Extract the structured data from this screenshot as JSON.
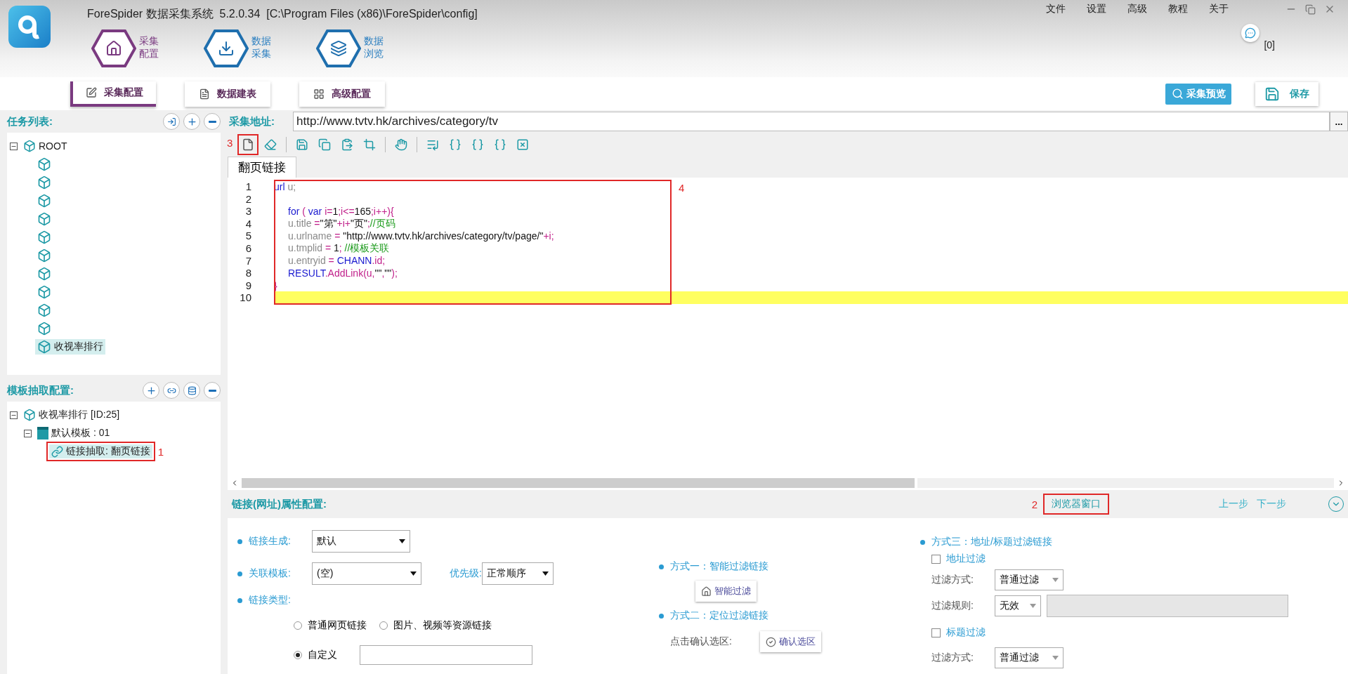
{
  "window": {
    "title": "ForeSpider 数据采集系统  5.2.0.34  [C:\\Program Files (x86)\\ForeSpider\\config]"
  },
  "menu": [
    "文件",
    "设置",
    "高级",
    "教程",
    "关于"
  ],
  "nav": [
    {
      "label": "采集配置",
      "selected": true
    },
    {
      "label": "数据采集",
      "selected": false
    },
    {
      "label": "数据浏览",
      "selected": false
    }
  ],
  "messages": {
    "count": "[0]"
  },
  "subtabs": [
    {
      "label": "采集配置",
      "selected": true
    },
    {
      "label": "数据建表",
      "selected": false
    },
    {
      "label": "高级配置",
      "selected": false
    }
  ],
  "actions": {
    "preview": "采集预览",
    "save": "保存"
  },
  "task_list": {
    "title": "任务列表:",
    "root": {
      "label": "ROOT",
      "expanded": true,
      "children": [
        {
          "selected": false
        },
        {
          "selected": false
        },
        {
          "selected": false
        },
        {
          "selected": false
        },
        {
          "selected": false
        },
        {
          "selected": false
        },
        {
          "selected": false
        },
        {
          "selected": false
        },
        {
          "selected": false
        },
        {
          "selected": false
        },
        {
          "label": "收视率排行",
          "selected": true
        }
      ]
    }
  },
  "template": {
    "title": "模板抽取配置:",
    "tree": [
      {
        "label": "收视率排行 [ID:25]",
        "kind": "task",
        "expanded": true,
        "selected": false,
        "children": [
          {
            "label": "默认模板 : 01",
            "kind": "template",
            "expanded": true,
            "selected": false,
            "children": [
              {
                "label": "链接抽取: 翻页链接",
                "kind": "link",
                "selected": true,
                "annotation": "1"
              }
            ]
          }
        ]
      }
    ]
  },
  "address": {
    "label": "采集地址:",
    "value": "http://www.tvtv.hk/archives/category/tv",
    "button": "..."
  },
  "toolbar": {
    "annotation": "3"
  },
  "editor_tabs": [
    {
      "label": "翻页链接",
      "selected": true
    }
  ],
  "editor": {
    "annotation": "4",
    "lines": [
      {
        "number": "1",
        "indented": false,
        "current": false,
        "tokens": [
          {
            "kind": "keyword",
            "text": "url"
          },
          {
            "kind": "member",
            "text": " u;"
          }
        ]
      },
      {
        "number": "2",
        "current": false
      },
      {
        "number": "3",
        "indented": true,
        "current": false,
        "tokens": [
          {
            "kind": "keyword",
            "text": "for"
          },
          {
            "kind": "punct",
            "text": " ( "
          },
          {
            "kind": "keyword",
            "text": "var"
          },
          {
            "kind": "punct",
            "text": " i="
          },
          {
            "kind": "plain",
            "text": "1"
          },
          {
            "kind": "punct",
            "text": ";i<="
          },
          {
            "kind": "plain",
            "text": "165"
          },
          {
            "kind": "punct",
            "text": ";i++){"
          }
        ]
      },
      {
        "number": "4",
        "indented": true,
        "current": false,
        "tokens": [
          {
            "kind": "member",
            "text": "u.title"
          },
          {
            "kind": "punct",
            "text": " ="
          },
          {
            "kind": "string",
            "text": "\"第\""
          },
          {
            "kind": "punct",
            "text": "+i+"
          },
          {
            "kind": "string",
            "text": "\"页\""
          },
          {
            "kind": "punct",
            "text": ";"
          },
          {
            "kind": "comment",
            "text": "//页码"
          }
        ]
      },
      {
        "number": "5",
        "indented": true,
        "current": false,
        "tokens": [
          {
            "kind": "member",
            "text": "u.urlname"
          },
          {
            "kind": "punct",
            "text": " = "
          },
          {
            "kind": "string",
            "text": "\"http://www.tvtv.hk/archives/category/tv/page/\""
          },
          {
            "kind": "punct",
            "text": "+i;"
          }
        ]
      },
      {
        "number": "6",
        "indented": true,
        "current": false,
        "tokens": [
          {
            "kind": "member",
            "text": "u.tmplid"
          },
          {
            "kind": "punct",
            "text": " = "
          },
          {
            "kind": "plain",
            "text": "1"
          },
          {
            "kind": "punct",
            "text": "; "
          },
          {
            "kind": "comment",
            "text": "//模板关联"
          }
        ]
      },
      {
        "number": "7",
        "indented": true,
        "current": false,
        "tokens": [
          {
            "kind": "member",
            "text": "u.entryid"
          },
          {
            "kind": "punct",
            "text": " = "
          },
          {
            "kind": "keyword",
            "text": "CHANN"
          },
          {
            "kind": "punct",
            "text": ".id;"
          }
        ]
      },
      {
        "number": "8",
        "indented": true,
        "current": false,
        "tokens": [
          {
            "kind": "keyword",
            "text": "RESULT"
          },
          {
            "kind": "punct",
            "text": ".AddLink(u,"
          },
          {
            "kind": "string",
            "text": "\"\""
          },
          {
            "kind": "punct",
            "text": ","
          },
          {
            "kind": "string",
            "text": "\"\""
          },
          {
            "kind": "punct",
            "text": ");"
          }
        ]
      },
      {
        "number": "9",
        "indented": false,
        "current": false,
        "tokens": [
          {
            "kind": "punct",
            "text": "}"
          }
        ]
      },
      {
        "number": "10",
        "current": true
      }
    ]
  },
  "properties": {
    "title": "链接(网址)属性配置:",
    "browser_button": {
      "label": "浏览器窗口",
      "annotation": "2"
    },
    "prev": "上一步",
    "next": "下一步",
    "link_gen": {
      "label": "链接生成:",
      "value": "默认"
    },
    "template": {
      "label": "关联模板:",
      "value": "(空)"
    },
    "priority": {
      "label": "优先级:",
      "value": "正常顺序"
    },
    "link_type": {
      "label": "链接类型:",
      "options": [
        {
          "label": "普通网页链接",
          "selected": false
        },
        {
          "label": "图片、视频等资源链接",
          "selected": false
        },
        {
          "label": "自定义",
          "selected": true
        }
      ]
    },
    "method1": {
      "label": "方式一：智能过滤链接",
      "button": "智能过滤"
    },
    "method2": {
      "label": "方式二：定位过滤链接",
      "prompt": "点击确认选区:",
      "button": "确认选区"
    },
    "method3": {
      "label": "方式三：地址/标题过滤链接",
      "url_filter": {
        "label": "地址过滤",
        "checked": false,
        "mode_label": "过滤方式:",
        "mode": "普通过滤",
        "rule_label": "过滤规则:",
        "rule": "无效"
      },
      "title_filter": {
        "label": "标题过滤",
        "checked": false,
        "mode_label": "过滤方式:",
        "mode": "普通过滤"
      }
    }
  }
}
